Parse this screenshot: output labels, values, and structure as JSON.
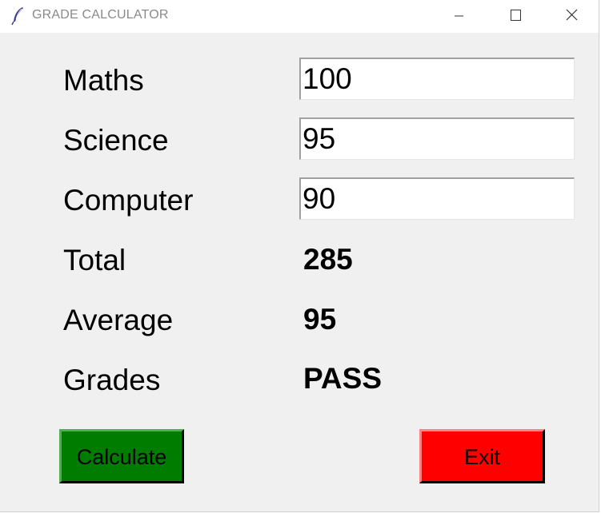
{
  "window": {
    "title": "GRADE CALCULATOR",
    "icon": "feather-icon"
  },
  "form": {
    "maths_label": "Maths",
    "maths_value": "100",
    "science_label": "Science",
    "science_value": "95",
    "computer_label": "Computer",
    "computer_value": "90"
  },
  "results": {
    "total_label": "Total",
    "total_value": "285",
    "average_label": "Average",
    "average_value": "95",
    "grades_label": "Grades",
    "grades_value": "PASS"
  },
  "buttons": {
    "calculate_label": "Calculate",
    "calculate_color": "#007c00",
    "exit_label": "Exit",
    "exit_color": "#ff0000"
  }
}
